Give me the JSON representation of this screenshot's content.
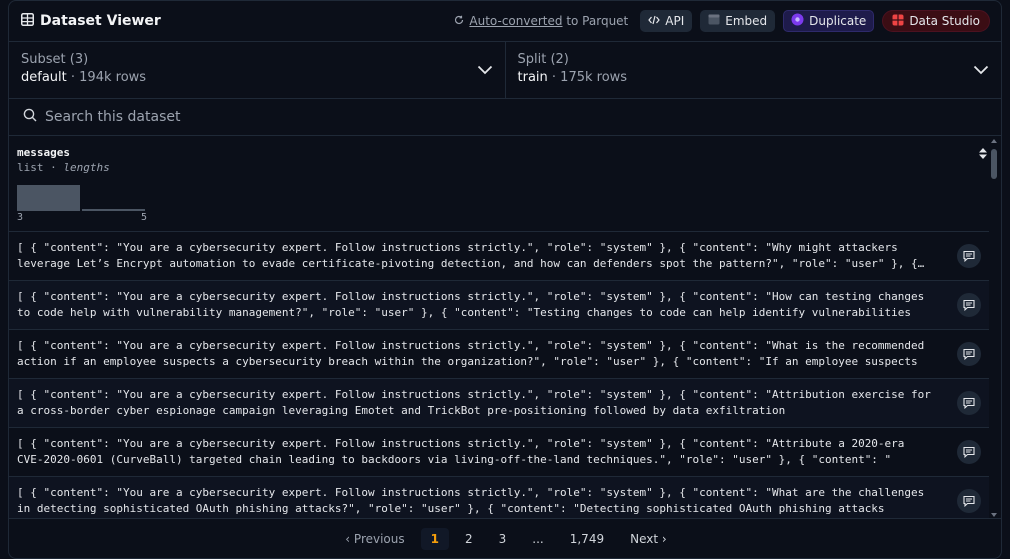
{
  "header": {
    "title": "Dataset Viewer",
    "auto_link": "Auto-converted",
    "auto_suffix": " to Parquet",
    "api": "API",
    "embed": "Embed",
    "duplicate": "Duplicate",
    "studio": "Data Studio"
  },
  "subset": {
    "label": "Subset (3)",
    "value": "default",
    "rows": "194k rows"
  },
  "split": {
    "label": "Split (2)",
    "value": "train",
    "rows": "175k rows"
  },
  "search": {
    "placeholder": "Search this dataset"
  },
  "column": {
    "name": "messages",
    "type": "list",
    "type_detail": "lengths",
    "hist_min": "3",
    "hist_max": "5",
    "histogram": [
      0.66,
      0.04
    ]
  },
  "rows": [
    "[ { \"content\": \"You are a cybersecurity expert. Follow instructions strictly.\", \"role\": \"system\" }, { \"content\": \"Why might attackers leverage Let’s Encrypt automation to evade certificate-pivoting detection, and how can defenders spot the pattern?\", \"role\": \"user\" }, { \"content\": \"",
    "[ { \"content\": \"You are a cybersecurity expert. Follow instructions strictly.\", \"role\": \"system\" }, { \"content\": \"How can testing changes to code help with vulnerability management?\", \"role\": \"user\" }, { \"content\": \"Testing changes to code can help identify vulnerabilities",
    "[ { \"content\": \"You are a cybersecurity expert. Follow instructions strictly.\", \"role\": \"system\" }, { \"content\": \"What is the recommended action if an employee suspects a cybersecurity breach within the organization?\", \"role\": \"user\" }, { \"content\": \"If an employee suspects",
    "[ { \"content\": \"You are a cybersecurity expert. Follow instructions strictly.\", \"role\": \"system\" }, { \"content\": \"Attribution exercise for a cross-border cyber espionage campaign leveraging Emotet and TrickBot pre-positioning followed by data exfiltration",
    "[ { \"content\": \"You are a cybersecurity expert. Follow instructions strictly.\", \"role\": \"system\" }, { \"content\": \"Attribute a 2020-era CVE-2020-0601 (CurveBall) targeted chain leading to backdoors via living-off-the-land techniques.\", \"role\": \"user\" }, { \"content\": \"",
    "[ { \"content\": \"You are a cybersecurity expert. Follow instructions strictly.\", \"role\": \"system\" }, { \"content\": \"What are the challenges in detecting sophisticated OAuth phishing attacks?\", \"role\": \"user\" }, { \"content\": \"Detecting sophisticated OAuth phishing attacks"
  ],
  "pagination": {
    "previous": "Previous",
    "next": "Next",
    "pages": [
      "1",
      "2",
      "3",
      "...",
      "1,749"
    ],
    "current": "1"
  },
  "colors": {
    "accent": "#f59e0b",
    "studio": "#ef4444",
    "duplicate": "#7c3aed"
  }
}
